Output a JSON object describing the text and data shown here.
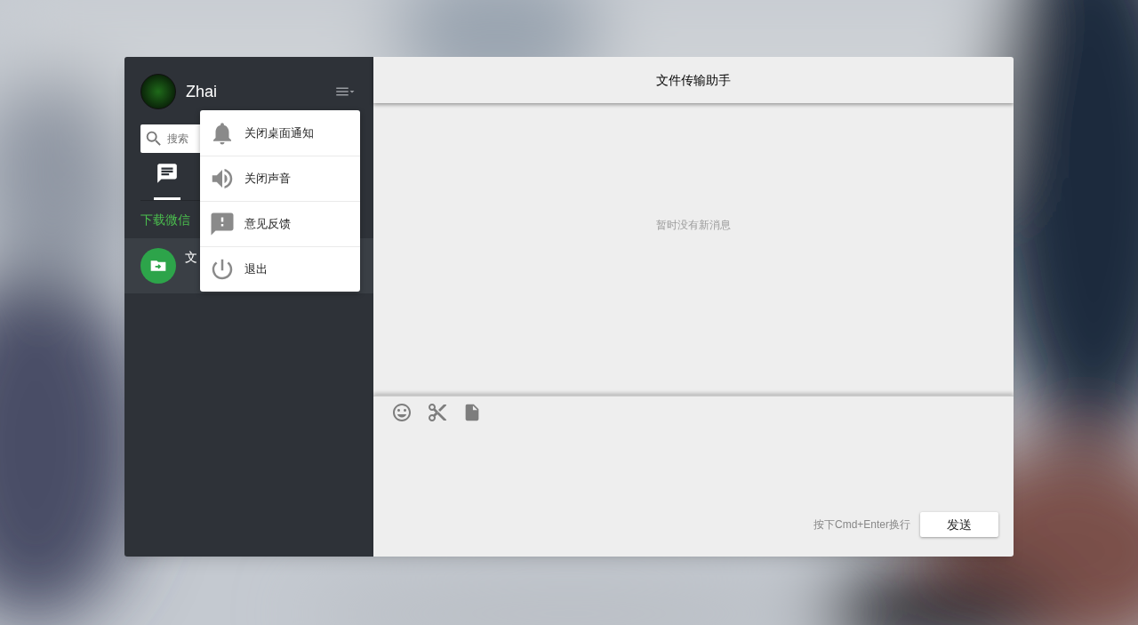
{
  "user": {
    "name": "Zhai"
  },
  "search": {
    "placeholder": "搜索"
  },
  "tabs": [
    {
      "selected": true
    }
  ],
  "download_banner": "下载微信",
  "chats": [
    {
      "name": "文",
      "selected": true
    }
  ],
  "menu": {
    "items": [
      {
        "label": "关闭桌面通知"
      },
      {
        "label": "关闭声音"
      },
      {
        "label": "意见反馈"
      },
      {
        "label": "退出"
      }
    ]
  },
  "chat": {
    "title": "文件传输助手",
    "empty_message": "暂时没有新消息",
    "hint": "按下Cmd+Enter换行",
    "send_button": "发送"
  }
}
